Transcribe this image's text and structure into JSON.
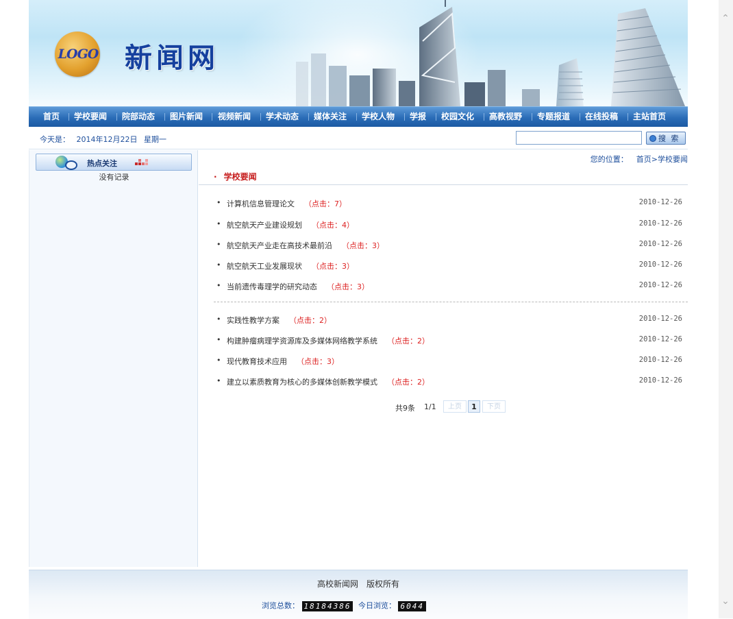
{
  "header": {
    "logo_text": "LOGO",
    "site_title": "新闻网"
  },
  "nav": [
    "首页",
    "学校要闻",
    "院部动态",
    "图片新闻",
    "视频新闻",
    "学术动态",
    "媒体关注",
    "学校人物",
    "学报",
    "校园文化",
    "高教视野",
    "专题报道",
    "在线投稿",
    "主站首页"
  ],
  "infobar": {
    "date_prefix": "今天是：",
    "date": "2014年12月22日",
    "weekday": "星期一",
    "search_value": "",
    "search_button": "搜 索"
  },
  "sidebar": {
    "hot_title": "热点关注",
    "empty_text": "没有记录"
  },
  "main": {
    "breadcrumb_label": "您的位置：",
    "breadcrumb_path": "首页>学校要闻",
    "category_bullet": "·",
    "category_title": "学校要闻",
    "articles": [
      {
        "title": "计算机信息管理论文",
        "hits": "（点击：7）",
        "date": "2010-12-26"
      },
      {
        "title": "航空航天产业建设规划",
        "hits": "（点击：4）",
        "date": "2010-12-26"
      },
      {
        "title": "航空航天产业走在高技术最前沿",
        "hits": "（点击：3）",
        "date": "2010-12-26"
      },
      {
        "title": "航空航天工业发展现状",
        "hits": "（点击：3）",
        "date": "2010-12-26"
      },
      {
        "title": "当前遗传毒理学的研究动态",
        "hits": "（点击：3）",
        "date": "2010-12-26"
      },
      {
        "title": "实践性教学方案",
        "hits": "（点击：2）",
        "date": "2010-12-26"
      },
      {
        "title": "构建肿瘤病理学资源库及多媒体网络教学系统",
        "hits": "（点击：2）",
        "date": "2010-12-26"
      },
      {
        "title": "现代教育技术应用",
        "hits": "（点击：3）",
        "date": "2010-12-26"
      },
      {
        "title": "建立以素质教育为核心的多媒体创新教学模式",
        "hits": "（点击：2）",
        "date": "2010-12-26"
      }
    ],
    "pager": {
      "total": "共9条",
      "pages": "1/1",
      "prev": "上页",
      "current": "1",
      "next": "下页"
    }
  },
  "footer": {
    "site_name": "高校新闻网",
    "rights": "版权所有",
    "total_label": "浏览总数：",
    "total_count": "18184386",
    "today_label": "今日浏览：",
    "today_count": "6044"
  }
}
